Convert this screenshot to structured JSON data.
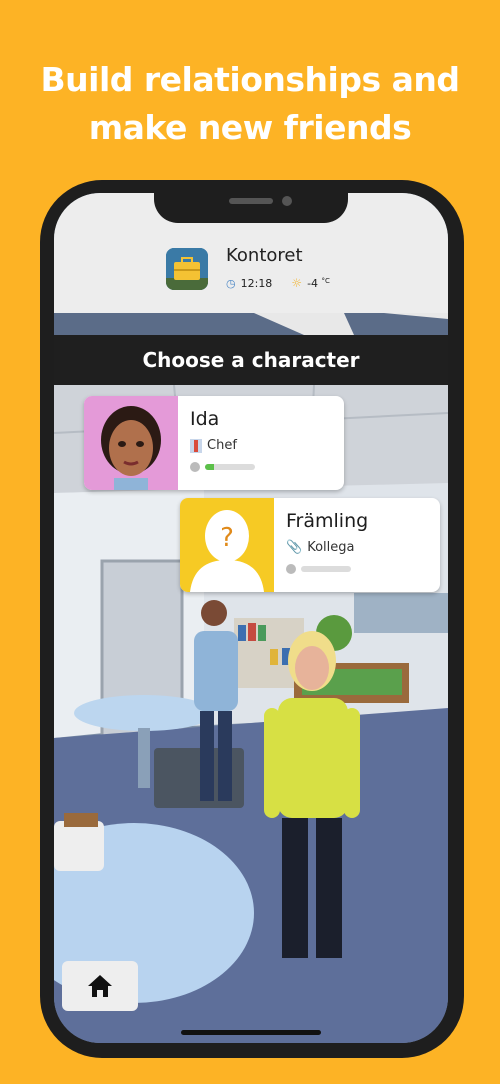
{
  "headline": {
    "line1": "Build relationships and",
    "line2": "make new friends"
  },
  "location": {
    "name": "Kontoret",
    "time": "12:18",
    "temperature": "-4",
    "temperature_unit": "°C",
    "icons": [
      "briefcase-icon",
      "clock-icon",
      "weather-icon"
    ]
  },
  "prompt": "Choose a character",
  "characters": [
    {
      "name": "Ida",
      "role": "Chef",
      "role_icon": "necktie-icon",
      "relationship_level": 0.18,
      "portrait_bg": "#E49AD8"
    },
    {
      "name": "Främling",
      "role": "Kollega",
      "role_icon": "paperclip-icon",
      "relationship_level": 0,
      "portrait_bg": "#F6CA24"
    }
  ],
  "colors": {
    "background": "#FDB325",
    "header": "#EDEDED",
    "choose_bar": "#1F1F1F",
    "relationship_fill": "#5CC04A"
  },
  "nav": {
    "home_icon": "home-icon"
  }
}
